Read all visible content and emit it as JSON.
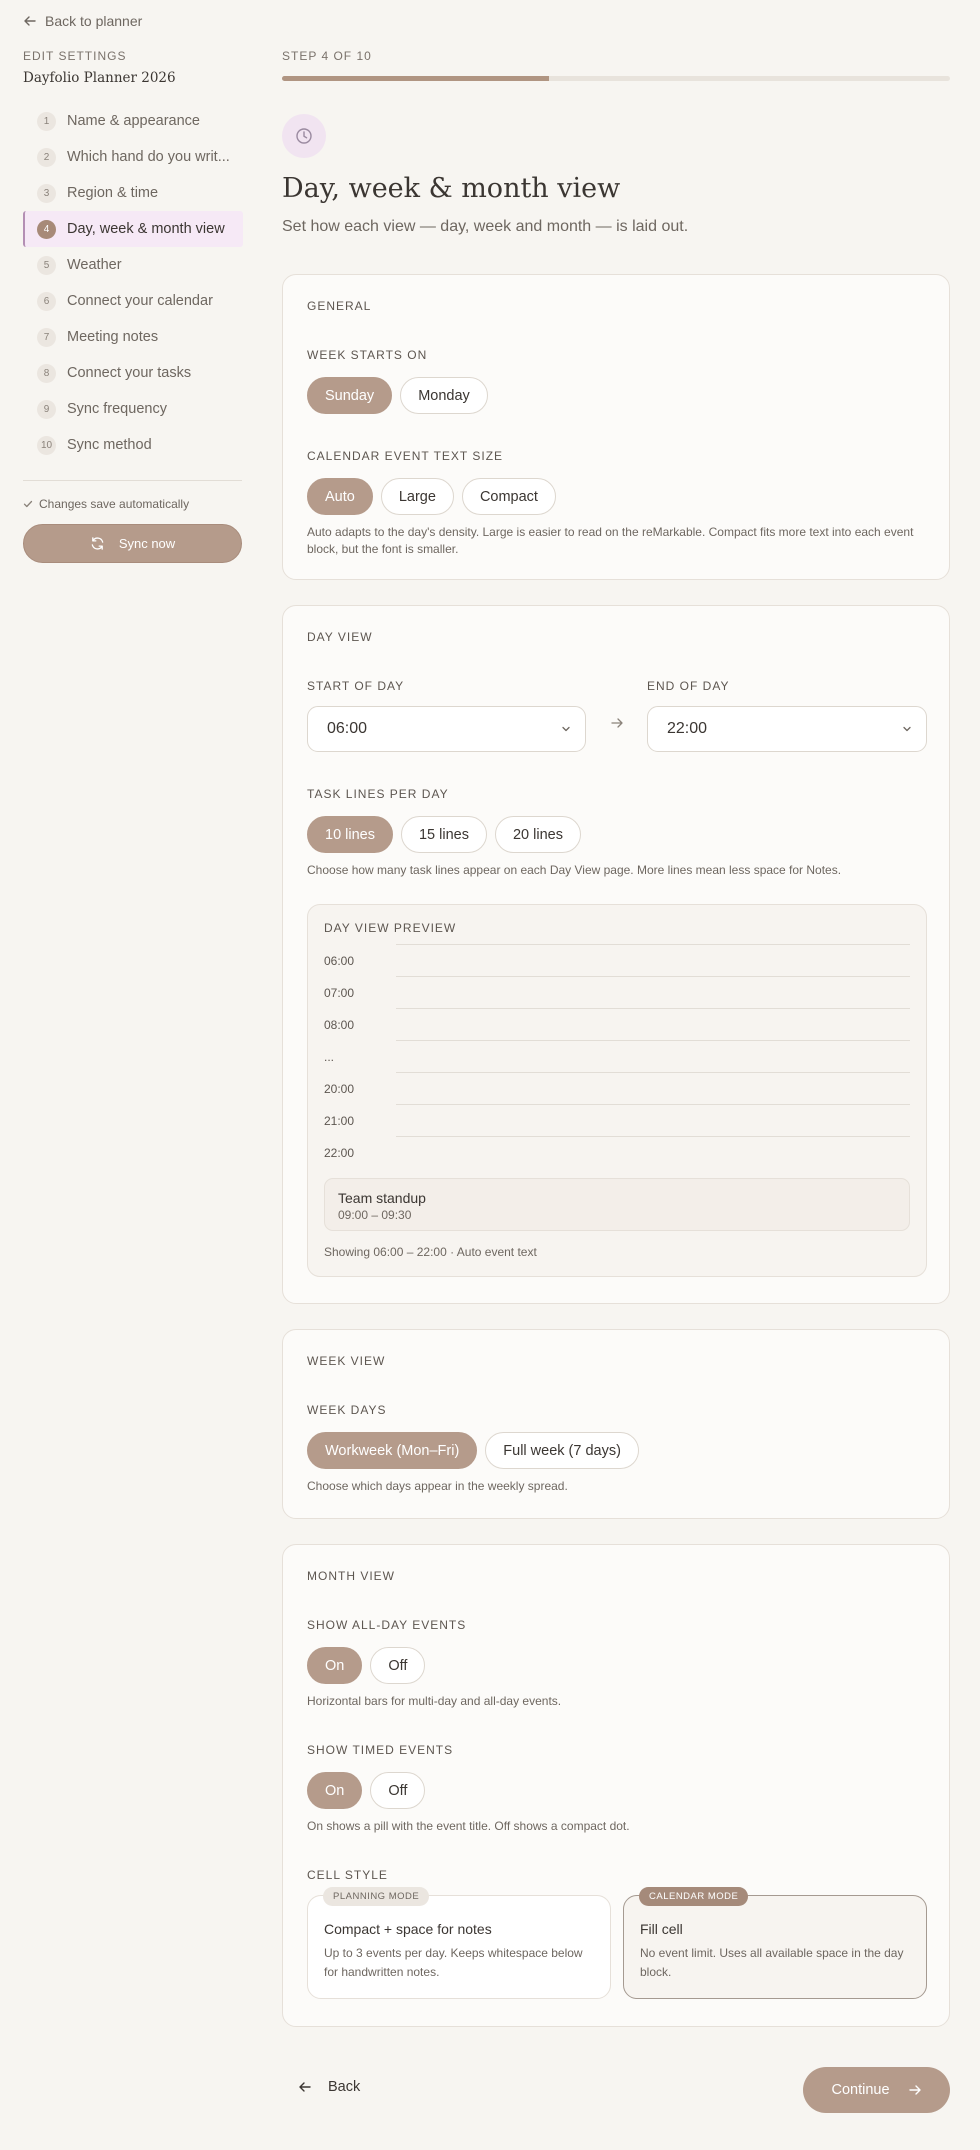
{
  "sidebar": {
    "back_label": "Back to planner",
    "section_label": "EDIT SETTINGS",
    "planner_name": "Dayfolio Planner 2026",
    "steps": [
      {
        "num": "1",
        "label": "Name & appearance"
      },
      {
        "num": "2",
        "label": "Which hand do you writ..."
      },
      {
        "num": "3",
        "label": "Region & time"
      },
      {
        "num": "4",
        "label": "Day, week & month view"
      },
      {
        "num": "5",
        "label": "Weather"
      },
      {
        "num": "6",
        "label": "Connect your calendar"
      },
      {
        "num": "7",
        "label": "Meeting notes"
      },
      {
        "num": "8",
        "label": "Connect your tasks"
      },
      {
        "num": "9",
        "label": "Sync frequency"
      },
      {
        "num": "10",
        "label": "Sync method"
      }
    ],
    "active_step": 4,
    "autosave_text": "Changes save automatically",
    "sync_label": "Sync now"
  },
  "header": {
    "step_counter": "STEP 4 OF 10",
    "progress": 0.4,
    "title": "Day, week & month view",
    "subtitle": "Set how each view — day, week and month — is laid out.",
    "icon": "clock-icon"
  },
  "general": {
    "title": "GENERAL",
    "week_starts_label": "WEEK STARTS ON",
    "week_starts_options": [
      "Sunday",
      "Monday"
    ],
    "week_starts_selected": "Sunday",
    "text_size_label": "CALENDAR EVENT TEXT SIZE",
    "text_size_options": [
      "Auto",
      "Large",
      "Compact"
    ],
    "text_size_selected": "Auto",
    "text_size_help": "Auto adapts to the day's density. Large is easier to read on the reMarkable. Compact fits more text into each event block, but the font is smaller."
  },
  "day_view": {
    "title": "DAY VIEW",
    "start_label": "START OF DAY",
    "start_value": "06:00",
    "end_label": "END OF DAY",
    "end_value": "22:00",
    "task_lines_label": "TASK LINES PER DAY",
    "task_lines_options": [
      "10 lines",
      "15 lines",
      "20 lines"
    ],
    "task_lines_selected": "10 lines",
    "task_lines_help": "Choose how many task lines appear on each Day View page. More lines mean less space for Notes.",
    "preview": {
      "title": "DAY VIEW PREVIEW",
      "times": [
        "06:00",
        "07:00",
        "08:00",
        "...",
        "20:00",
        "21:00",
        "22:00"
      ],
      "event_name": "Team standup",
      "event_time": "09:00 – 09:30",
      "footer": "Showing 06:00 – 22:00 · Auto event text"
    }
  },
  "week_view": {
    "title": "WEEK VIEW",
    "days_label": "WEEK DAYS",
    "days_options": [
      "Workweek (Mon–Fri)",
      "Full week (7 days)"
    ],
    "days_selected": "Workweek (Mon–Fri)",
    "days_help": "Choose which days appear in the weekly spread."
  },
  "month_view": {
    "title": "MONTH VIEW",
    "allday_label": "SHOW ALL-DAY EVENTS",
    "allday_options": [
      "On",
      "Off"
    ],
    "allday_selected": "On",
    "allday_help": "Horizontal bars for multi-day and all-day events.",
    "timed_label": "SHOW TIMED EVENTS",
    "timed_options": [
      "On",
      "Off"
    ],
    "timed_selected": "On",
    "timed_help": "On shows a pill with the event title. Off shows a compact dot.",
    "cell_style_label": "CELL STYLE",
    "cell_styles": [
      {
        "tag": "PLANNING MODE",
        "title": "Compact + space for notes",
        "desc": "Up to 3 events per day. Keeps whitespace below for handwritten notes."
      },
      {
        "tag": "CALENDAR MODE",
        "title": "Fill cell",
        "desc": "No event limit. Uses all available space in the day block."
      }
    ],
    "cell_style_selected": "Fill cell"
  },
  "footer": {
    "back_label": "Back",
    "continue_label": "Continue"
  },
  "colors": {
    "accent": "#b59b8b",
    "active_nav_bg": "#f6e9f6",
    "background": "#f7f5f1"
  }
}
